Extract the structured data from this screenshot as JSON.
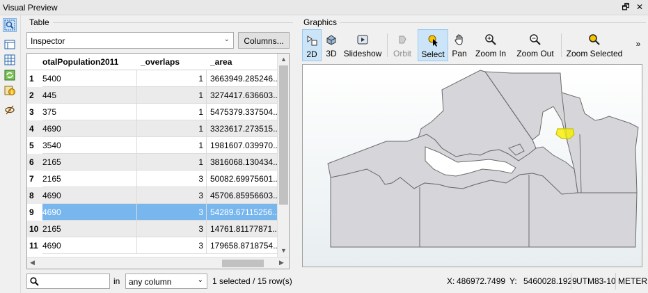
{
  "window": {
    "title": "Visual Preview",
    "restore_glyph": "🗗",
    "close_glyph": "✕"
  },
  "left_tools": [
    "inspector-mode-icon",
    "table-layout-icon",
    "grid-icon",
    "map-refresh-icon",
    "info-icon",
    "eye-hide-icon"
  ],
  "table_panel": {
    "label": "Table",
    "source_select": "Inspector",
    "columns_button": "Columns...",
    "headers": [
      "otalPopulation2011",
      "_overlaps",
      "_area"
    ],
    "rows": [
      {
        "n": "1",
        "pop": "5400",
        "overlaps": "1",
        "area": "3663949.285246..."
      },
      {
        "n": "2",
        "pop": "445",
        "overlaps": "1",
        "area": "3274417.636603..."
      },
      {
        "n": "3",
        "pop": "375",
        "overlaps": "1",
        "area": "5475379.337504..."
      },
      {
        "n": "4",
        "pop": "4690",
        "overlaps": "1",
        "area": "3323617.273515..."
      },
      {
        "n": "5",
        "pop": "3540",
        "overlaps": "1",
        "area": "1981607.039970..."
      },
      {
        "n": "6",
        "pop": "2165",
        "overlaps": "1",
        "area": "3816068.130434..."
      },
      {
        "n": "7",
        "pop": "2165",
        "overlaps": "3",
        "area": "50082.69975601..."
      },
      {
        "n": "8",
        "pop": "4690",
        "overlaps": "3",
        "area": "45706.85956603..."
      },
      {
        "n": "9",
        "pop": "4690",
        "overlaps": "3",
        "area": "54289.67115256..."
      },
      {
        "n": "10",
        "pop": "2165",
        "overlaps": "3",
        "area": "14761.81177871..."
      },
      {
        "n": "11",
        "pop": "4690",
        "overlaps": "3",
        "area": "179658.8718754..."
      }
    ],
    "selected_row": 9,
    "search_placeholder": "",
    "in_label": "in",
    "column_filter": "any column",
    "status": "1 selected / 15 row(s)"
  },
  "graphics_panel": {
    "label": "Graphics",
    "tools": [
      {
        "id": "2d",
        "label": "2D",
        "icon": "2d-view-icon",
        "active": true
      },
      {
        "id": "3d",
        "label": "3D",
        "icon": "3d-view-icon"
      },
      {
        "id": "slideshow",
        "label": "Slideshow",
        "icon": "slideshow-icon"
      },
      {
        "id": "orbit",
        "label": "Orbit",
        "icon": "orbit-icon",
        "disabled": true
      },
      {
        "id": "select",
        "label": "Select",
        "icon": "select-cursor-icon",
        "active": true
      },
      {
        "id": "pan",
        "label": "Pan",
        "icon": "hand-pan-icon"
      },
      {
        "id": "zoomin",
        "label": "Zoom In",
        "icon": "zoom-in-icon"
      },
      {
        "id": "zoomout",
        "label": "Zoom Out",
        "icon": "zoom-out-icon"
      },
      {
        "id": "zoomsel",
        "label": "Zoom Selected",
        "icon": "zoom-selected-icon"
      }
    ],
    "overflow": "»",
    "status": {
      "x_label": "X:",
      "x_value": "486972.7499",
      "y_label": "Y:",
      "y_value": "5460028.1929",
      "crs": "UTM83-10",
      "units": "METER"
    }
  },
  "colors": {
    "selection": "#78b6ee",
    "feature_fill": "#d6d6da",
    "highlight": "#f5f000"
  }
}
